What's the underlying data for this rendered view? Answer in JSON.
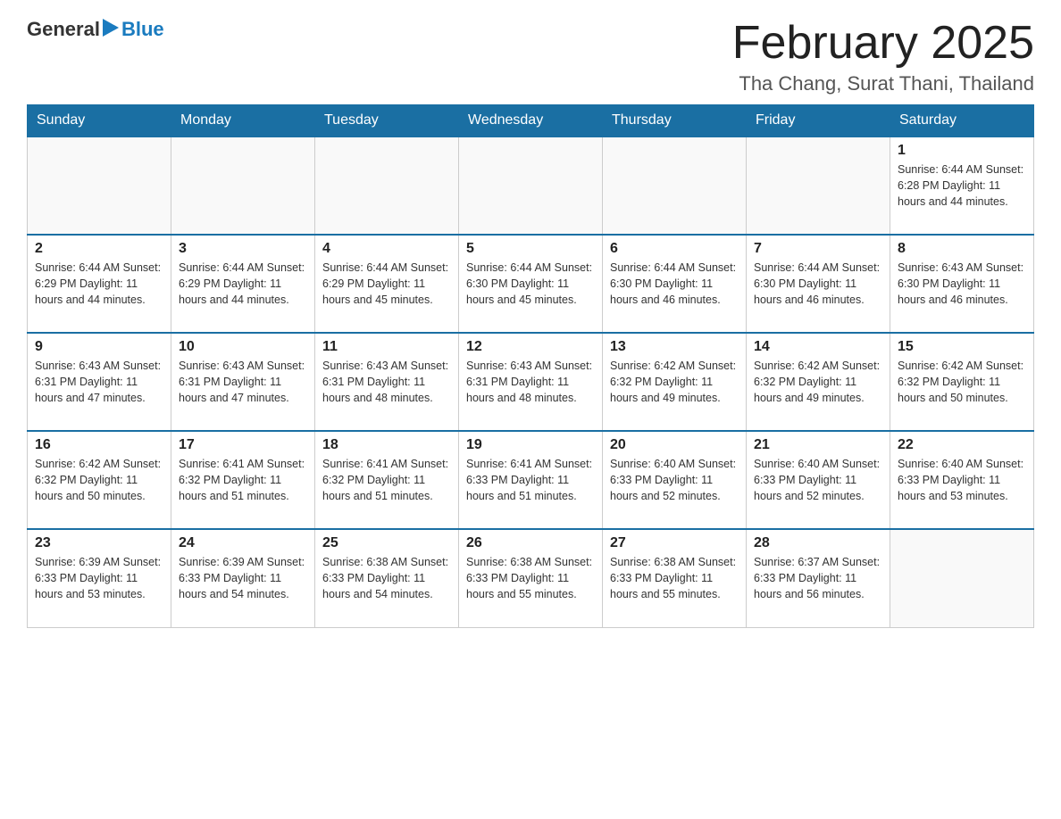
{
  "header": {
    "logo_general": "General",
    "logo_blue": "Blue",
    "month_title": "February 2025",
    "location": "Tha Chang, Surat Thani, Thailand"
  },
  "days_of_week": [
    "Sunday",
    "Monday",
    "Tuesday",
    "Wednesday",
    "Thursday",
    "Friday",
    "Saturday"
  ],
  "weeks": [
    [
      {
        "day": "",
        "info": ""
      },
      {
        "day": "",
        "info": ""
      },
      {
        "day": "",
        "info": ""
      },
      {
        "day": "",
        "info": ""
      },
      {
        "day": "",
        "info": ""
      },
      {
        "day": "",
        "info": ""
      },
      {
        "day": "1",
        "info": "Sunrise: 6:44 AM\nSunset: 6:28 PM\nDaylight: 11 hours\nand 44 minutes."
      }
    ],
    [
      {
        "day": "2",
        "info": "Sunrise: 6:44 AM\nSunset: 6:29 PM\nDaylight: 11 hours\nand 44 minutes."
      },
      {
        "day": "3",
        "info": "Sunrise: 6:44 AM\nSunset: 6:29 PM\nDaylight: 11 hours\nand 44 minutes."
      },
      {
        "day": "4",
        "info": "Sunrise: 6:44 AM\nSunset: 6:29 PM\nDaylight: 11 hours\nand 45 minutes."
      },
      {
        "day": "5",
        "info": "Sunrise: 6:44 AM\nSunset: 6:30 PM\nDaylight: 11 hours\nand 45 minutes."
      },
      {
        "day": "6",
        "info": "Sunrise: 6:44 AM\nSunset: 6:30 PM\nDaylight: 11 hours\nand 46 minutes."
      },
      {
        "day": "7",
        "info": "Sunrise: 6:44 AM\nSunset: 6:30 PM\nDaylight: 11 hours\nand 46 minutes."
      },
      {
        "day": "8",
        "info": "Sunrise: 6:43 AM\nSunset: 6:30 PM\nDaylight: 11 hours\nand 46 minutes."
      }
    ],
    [
      {
        "day": "9",
        "info": "Sunrise: 6:43 AM\nSunset: 6:31 PM\nDaylight: 11 hours\nand 47 minutes."
      },
      {
        "day": "10",
        "info": "Sunrise: 6:43 AM\nSunset: 6:31 PM\nDaylight: 11 hours\nand 47 minutes."
      },
      {
        "day": "11",
        "info": "Sunrise: 6:43 AM\nSunset: 6:31 PM\nDaylight: 11 hours\nand 48 minutes."
      },
      {
        "day": "12",
        "info": "Sunrise: 6:43 AM\nSunset: 6:31 PM\nDaylight: 11 hours\nand 48 minutes."
      },
      {
        "day": "13",
        "info": "Sunrise: 6:42 AM\nSunset: 6:32 PM\nDaylight: 11 hours\nand 49 minutes."
      },
      {
        "day": "14",
        "info": "Sunrise: 6:42 AM\nSunset: 6:32 PM\nDaylight: 11 hours\nand 49 minutes."
      },
      {
        "day": "15",
        "info": "Sunrise: 6:42 AM\nSunset: 6:32 PM\nDaylight: 11 hours\nand 50 minutes."
      }
    ],
    [
      {
        "day": "16",
        "info": "Sunrise: 6:42 AM\nSunset: 6:32 PM\nDaylight: 11 hours\nand 50 minutes."
      },
      {
        "day": "17",
        "info": "Sunrise: 6:41 AM\nSunset: 6:32 PM\nDaylight: 11 hours\nand 51 minutes."
      },
      {
        "day": "18",
        "info": "Sunrise: 6:41 AM\nSunset: 6:32 PM\nDaylight: 11 hours\nand 51 minutes."
      },
      {
        "day": "19",
        "info": "Sunrise: 6:41 AM\nSunset: 6:33 PM\nDaylight: 11 hours\nand 51 minutes."
      },
      {
        "day": "20",
        "info": "Sunrise: 6:40 AM\nSunset: 6:33 PM\nDaylight: 11 hours\nand 52 minutes."
      },
      {
        "day": "21",
        "info": "Sunrise: 6:40 AM\nSunset: 6:33 PM\nDaylight: 11 hours\nand 52 minutes."
      },
      {
        "day": "22",
        "info": "Sunrise: 6:40 AM\nSunset: 6:33 PM\nDaylight: 11 hours\nand 53 minutes."
      }
    ],
    [
      {
        "day": "23",
        "info": "Sunrise: 6:39 AM\nSunset: 6:33 PM\nDaylight: 11 hours\nand 53 minutes."
      },
      {
        "day": "24",
        "info": "Sunrise: 6:39 AM\nSunset: 6:33 PM\nDaylight: 11 hours\nand 54 minutes."
      },
      {
        "day": "25",
        "info": "Sunrise: 6:38 AM\nSunset: 6:33 PM\nDaylight: 11 hours\nand 54 minutes."
      },
      {
        "day": "26",
        "info": "Sunrise: 6:38 AM\nSunset: 6:33 PM\nDaylight: 11 hours\nand 55 minutes."
      },
      {
        "day": "27",
        "info": "Sunrise: 6:38 AM\nSunset: 6:33 PM\nDaylight: 11 hours\nand 55 minutes."
      },
      {
        "day": "28",
        "info": "Sunrise: 6:37 AM\nSunset: 6:33 PM\nDaylight: 11 hours\nand 56 minutes."
      },
      {
        "day": "",
        "info": ""
      }
    ]
  ]
}
